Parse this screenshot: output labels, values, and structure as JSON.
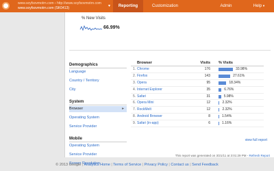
{
  "header": {
    "account_line1": "www.soyfsovmotrn.com › http://www.soyfsovmotrn.com",
    "account_line2": "www.soyfsovmotrn.com (SK0413)",
    "nav": {
      "reporting": "Reporting",
      "customization": "Customization",
      "admin": "Admin",
      "help": "Help"
    }
  },
  "summary": {
    "label": "% New Visits",
    "value": "66.99%"
  },
  "sidebar": {
    "demographics_heading": "Demographics",
    "demographics": [
      "Language",
      "Country / Territory",
      "City"
    ],
    "system_heading": "System",
    "system": [
      "Browser",
      "Operating System",
      "Service Provider"
    ],
    "mobile_heading": "Mobile",
    "mobile": [
      "Operating System",
      "Service Provider",
      "Screen Resolution"
    ]
  },
  "table": {
    "headers": {
      "browser": "Browser",
      "visits": "Visits",
      "pct_visits": "% Visits"
    },
    "rows": [
      {
        "rank": "1.",
        "name": "Chrome",
        "visits": "176",
        "pct": "33.98%",
        "fraction": 0.3398
      },
      {
        "rank": "2.",
        "name": "Firefox",
        "visits": "143",
        "pct": "27.61%",
        "fraction": 0.2761
      },
      {
        "rank": "3.",
        "name": "Opera",
        "visits": "95",
        "pct": "18.34%",
        "fraction": 0.1834
      },
      {
        "rank": "4.",
        "name": "Internet Explorer",
        "visits": "35",
        "pct": "6.76%",
        "fraction": 0.0676
      },
      {
        "rank": "5.",
        "name": "Safari",
        "visits": "31",
        "pct": "5.98%",
        "fraction": 0.0598
      },
      {
        "rank": "6.",
        "name": "Opera Mini",
        "visits": "12",
        "pct": "2.32%",
        "fraction": 0.0232
      },
      {
        "rank": "7.",
        "name": "RockMelt",
        "visits": "12",
        "pct": "2.32%",
        "fraction": 0.0232
      },
      {
        "rank": "8.",
        "name": "Android Browser",
        "visits": "8",
        "pct": "1.54%",
        "fraction": 0.0154
      },
      {
        "rank": "9.",
        "name": "Safari (in-app)",
        "visits": "6",
        "pct": "1.16%",
        "fraction": 0.0116
      }
    ],
    "view_full": "view full report"
  },
  "generated": {
    "text": "This report was generated on 3/21/11 at 3:01:29 PM - ",
    "refresh": "Refresh Report"
  },
  "footer": {
    "copyright": "© 2013 Google",
    "links": [
      "Analytics Home",
      "Terms of Service",
      "Privacy Policy",
      "Contact us",
      "Send Feedback"
    ]
  },
  "colors": {
    "topbar": "#e0671c",
    "link": "#2a6bc9",
    "bar": "#5a8bd6"
  }
}
